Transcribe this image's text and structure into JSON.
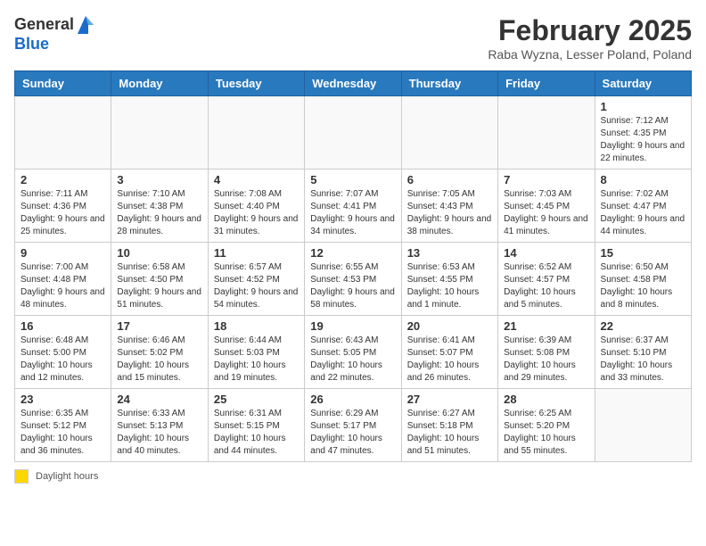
{
  "logo": {
    "general": "General",
    "blue": "Blue"
  },
  "title": "February 2025",
  "location": "Raba Wyzna, Lesser Poland, Poland",
  "days_of_week": [
    "Sunday",
    "Monday",
    "Tuesday",
    "Wednesday",
    "Thursday",
    "Friday",
    "Saturday"
  ],
  "weeks": [
    [
      {
        "day": "",
        "info": ""
      },
      {
        "day": "",
        "info": ""
      },
      {
        "day": "",
        "info": ""
      },
      {
        "day": "",
        "info": ""
      },
      {
        "day": "",
        "info": ""
      },
      {
        "day": "",
        "info": ""
      },
      {
        "day": "1",
        "info": "Sunrise: 7:12 AM\nSunset: 4:35 PM\nDaylight: 9 hours and 22 minutes."
      }
    ],
    [
      {
        "day": "2",
        "info": "Sunrise: 7:11 AM\nSunset: 4:36 PM\nDaylight: 9 hours and 25 minutes."
      },
      {
        "day": "3",
        "info": "Sunrise: 7:10 AM\nSunset: 4:38 PM\nDaylight: 9 hours and 28 minutes."
      },
      {
        "day": "4",
        "info": "Sunrise: 7:08 AM\nSunset: 4:40 PM\nDaylight: 9 hours and 31 minutes."
      },
      {
        "day": "5",
        "info": "Sunrise: 7:07 AM\nSunset: 4:41 PM\nDaylight: 9 hours and 34 minutes."
      },
      {
        "day": "6",
        "info": "Sunrise: 7:05 AM\nSunset: 4:43 PM\nDaylight: 9 hours and 38 minutes."
      },
      {
        "day": "7",
        "info": "Sunrise: 7:03 AM\nSunset: 4:45 PM\nDaylight: 9 hours and 41 minutes."
      },
      {
        "day": "8",
        "info": "Sunrise: 7:02 AM\nSunset: 4:47 PM\nDaylight: 9 hours and 44 minutes."
      }
    ],
    [
      {
        "day": "9",
        "info": "Sunrise: 7:00 AM\nSunset: 4:48 PM\nDaylight: 9 hours and 48 minutes."
      },
      {
        "day": "10",
        "info": "Sunrise: 6:58 AM\nSunset: 4:50 PM\nDaylight: 9 hours and 51 minutes."
      },
      {
        "day": "11",
        "info": "Sunrise: 6:57 AM\nSunset: 4:52 PM\nDaylight: 9 hours and 54 minutes."
      },
      {
        "day": "12",
        "info": "Sunrise: 6:55 AM\nSunset: 4:53 PM\nDaylight: 9 hours and 58 minutes."
      },
      {
        "day": "13",
        "info": "Sunrise: 6:53 AM\nSunset: 4:55 PM\nDaylight: 10 hours and 1 minute."
      },
      {
        "day": "14",
        "info": "Sunrise: 6:52 AM\nSunset: 4:57 PM\nDaylight: 10 hours and 5 minutes."
      },
      {
        "day": "15",
        "info": "Sunrise: 6:50 AM\nSunset: 4:58 PM\nDaylight: 10 hours and 8 minutes."
      }
    ],
    [
      {
        "day": "16",
        "info": "Sunrise: 6:48 AM\nSunset: 5:00 PM\nDaylight: 10 hours and 12 minutes."
      },
      {
        "day": "17",
        "info": "Sunrise: 6:46 AM\nSunset: 5:02 PM\nDaylight: 10 hours and 15 minutes."
      },
      {
        "day": "18",
        "info": "Sunrise: 6:44 AM\nSunset: 5:03 PM\nDaylight: 10 hours and 19 minutes."
      },
      {
        "day": "19",
        "info": "Sunrise: 6:43 AM\nSunset: 5:05 PM\nDaylight: 10 hours and 22 minutes."
      },
      {
        "day": "20",
        "info": "Sunrise: 6:41 AM\nSunset: 5:07 PM\nDaylight: 10 hours and 26 minutes."
      },
      {
        "day": "21",
        "info": "Sunrise: 6:39 AM\nSunset: 5:08 PM\nDaylight: 10 hours and 29 minutes."
      },
      {
        "day": "22",
        "info": "Sunrise: 6:37 AM\nSunset: 5:10 PM\nDaylight: 10 hours and 33 minutes."
      }
    ],
    [
      {
        "day": "23",
        "info": "Sunrise: 6:35 AM\nSunset: 5:12 PM\nDaylight: 10 hours and 36 minutes."
      },
      {
        "day": "24",
        "info": "Sunrise: 6:33 AM\nSunset: 5:13 PM\nDaylight: 10 hours and 40 minutes."
      },
      {
        "day": "25",
        "info": "Sunrise: 6:31 AM\nSunset: 5:15 PM\nDaylight: 10 hours and 44 minutes."
      },
      {
        "day": "26",
        "info": "Sunrise: 6:29 AM\nSunset: 5:17 PM\nDaylight: 10 hours and 47 minutes."
      },
      {
        "day": "27",
        "info": "Sunrise: 6:27 AM\nSunset: 5:18 PM\nDaylight: 10 hours and 51 minutes."
      },
      {
        "day": "28",
        "info": "Sunrise: 6:25 AM\nSunset: 5:20 PM\nDaylight: 10 hours and 55 minutes."
      },
      {
        "day": "",
        "info": ""
      }
    ]
  ],
  "footer": {
    "daylight_label": "Daylight hours"
  }
}
